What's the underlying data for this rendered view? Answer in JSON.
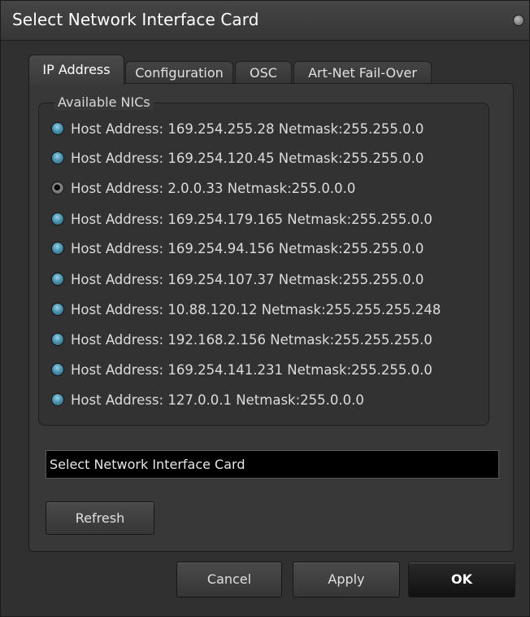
{
  "window": {
    "title": "Select Network Interface Card"
  },
  "tabs": [
    {
      "label": "IP Address",
      "active": true
    },
    {
      "label": "Configuration",
      "active": false
    },
    {
      "label": "OSC",
      "active": false
    },
    {
      "label": "Art-Net Fail-Over",
      "active": false
    }
  ],
  "group": {
    "title": "Available NICs"
  },
  "nics": [
    {
      "label": "Host Address: 169.254.255.28 Netmask:255.255.0.0",
      "selected": false
    },
    {
      "label": "Host Address: 169.254.120.45 Netmask:255.255.0.0",
      "selected": false
    },
    {
      "label": "Host Address: 2.0.0.33 Netmask:255.0.0.0",
      "selected": true
    },
    {
      "label": "Host Address: 169.254.179.165 Netmask:255.255.0.0",
      "selected": false
    },
    {
      "label": "Host Address: 169.254.94.156 Netmask:255.255.0.0",
      "selected": false
    },
    {
      "label": "Host Address: 169.254.107.37 Netmask:255.255.0.0",
      "selected": false
    },
    {
      "label": "Host Address: 10.88.120.12 Netmask:255.255.255.248",
      "selected": false
    },
    {
      "label": "Host Address: 192.168.2.156 Netmask:255.255.255.0",
      "selected": false
    },
    {
      "label": "Host Address: 169.254.141.231 Netmask:255.255.0.0",
      "selected": false
    },
    {
      "label": "Host Address: 127.0.0.1 Netmask:255.0.0.0",
      "selected": false
    }
  ],
  "status": {
    "text": "Select Network Interface Card"
  },
  "buttons": {
    "refresh": "Refresh",
    "cancel": "Cancel",
    "apply": "Apply",
    "ok": "OK"
  }
}
